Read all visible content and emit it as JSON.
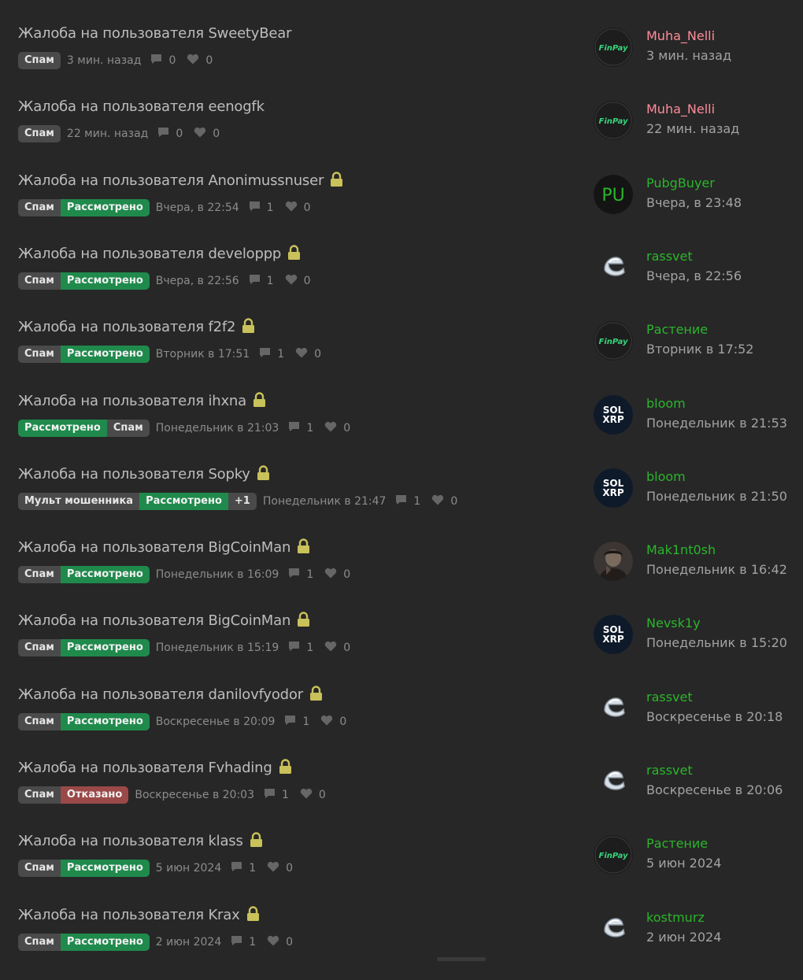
{
  "colors": {
    "background": "#272727",
    "tag_gray": "#4a4a4a",
    "tag_green": "#1f8a4c",
    "tag_red": "#9b4848",
    "user_pink": "#ff8c9a",
    "user_green": "#2bb52b",
    "lock": "#c9c15a"
  },
  "threads": [
    {
      "title": "Жалоба на пользователя SweetyBear",
      "locked": false,
      "tags": [
        {
          "label": "Спам",
          "kind": "gray"
        }
      ],
      "date": "3 мин. назад",
      "replies": "0",
      "likes": "0",
      "user": "Muha_Nelli",
      "user_color": "#ff8c9a",
      "user_date": "3 мин. назад",
      "avatar": "finpay"
    },
    {
      "title": "Жалоба на пользователя eenogfk",
      "locked": false,
      "tags": [
        {
          "label": "Спам",
          "kind": "gray"
        }
      ],
      "date": "22 мин. назад",
      "replies": "0",
      "likes": "0",
      "user": "Muha_Nelli",
      "user_color": "#ff8c9a",
      "user_date": "22 мин. назад",
      "avatar": "finpay"
    },
    {
      "title": "Жалоба на пользователя Anonimussnuser",
      "locked": true,
      "tags": [
        {
          "label": "Спам",
          "kind": "gray"
        },
        {
          "label": "Рассмотрено",
          "kind": "green"
        }
      ],
      "date": "Вчера, в 22:54",
      "replies": "1",
      "likes": "0",
      "user": "PubgBuyer",
      "user_color": "#2bb52b",
      "user_date": "Вчера, в 23:48",
      "avatar": "pu",
      "avatar_text": "PU"
    },
    {
      "title": "Жалоба на пользователя developpp",
      "locked": true,
      "tags": [
        {
          "label": "Спам",
          "kind": "gray"
        },
        {
          "label": "Рассмотрено",
          "kind": "green"
        }
      ],
      "date": "Вчера, в 22:56",
      "replies": "1",
      "likes": "0",
      "user": "rassvet",
      "user_color": "#2bb52b",
      "user_date": "Вчера, в 22:56",
      "avatar": "e"
    },
    {
      "title": "Жалоба на пользователя f2f2",
      "locked": true,
      "tags": [
        {
          "label": "Спам",
          "kind": "gray"
        },
        {
          "label": "Рассмотрено",
          "kind": "green"
        }
      ],
      "date": "Вторник в 17:51",
      "replies": "1",
      "likes": "0",
      "user": "Растение",
      "user_color": "#2bb52b",
      "user_date": "Вторник в 17:52",
      "avatar": "finpay"
    },
    {
      "title": "Жалоба на пользователя ihxna",
      "locked": true,
      "tags": [
        {
          "label": "Рассмотрено",
          "kind": "green"
        },
        {
          "label": "Спам",
          "kind": "gray"
        }
      ],
      "date": "Понедельник в 21:03",
      "replies": "1",
      "likes": "0",
      "user": "bloom",
      "user_color": "#2bb52b",
      "user_date": "Понедельник в 21:53",
      "avatar": "solxrp",
      "avatar_line1": "SOL",
      "avatar_line2": "XRP"
    },
    {
      "title": "Жалоба на пользователя Sopky",
      "locked": true,
      "tags": [
        {
          "label": "Мульт мошенника",
          "kind": "gray"
        },
        {
          "label": "Рассмотрено",
          "kind": "green"
        },
        {
          "label": "+1",
          "kind": "more"
        }
      ],
      "date": "Понедельник в 21:47",
      "replies": "1",
      "likes": "0",
      "user": "bloom",
      "user_color": "#2bb52b",
      "user_date": "Понедельник в 21:50",
      "avatar": "solxrp",
      "avatar_line1": "SOL",
      "avatar_line2": "XRP"
    },
    {
      "title": "Жалоба на пользователя BigCoinMan",
      "locked": true,
      "tags": [
        {
          "label": "Спам",
          "kind": "gray"
        },
        {
          "label": "Рассмотрено",
          "kind": "green"
        }
      ],
      "date": "Понедельник в 16:09",
      "replies": "1",
      "likes": "0",
      "user": "Mak1nt0sh",
      "user_color": "#2bb52b",
      "user_date": "Понедельник в 16:42",
      "avatar": "photo"
    },
    {
      "title": "Жалоба на пользователя BigCoinMan",
      "locked": true,
      "tags": [
        {
          "label": "Спам",
          "kind": "gray"
        },
        {
          "label": "Рассмотрено",
          "kind": "green"
        }
      ],
      "date": "Понедельник в 15:19",
      "replies": "1",
      "likes": "0",
      "user": "Nevsk1y",
      "user_color": "#2bb52b",
      "user_date": "Понедельник в 15:20",
      "avatar": "solxrp",
      "avatar_line1": "SOL",
      "avatar_line2": "XRP"
    },
    {
      "title": "Жалоба на пользователя danilovfyodor",
      "locked": true,
      "tags": [
        {
          "label": "Спам",
          "kind": "gray"
        },
        {
          "label": "Рассмотрено",
          "kind": "green"
        }
      ],
      "date": "Воскресенье в 20:09",
      "replies": "1",
      "likes": "0",
      "user": "rassvet",
      "user_color": "#2bb52b",
      "user_date": "Воскресенье в 20:18",
      "avatar": "e"
    },
    {
      "title": "Жалоба на пользователя Fvhading",
      "locked": true,
      "tags": [
        {
          "label": "Спам",
          "kind": "gray"
        },
        {
          "label": "Отказано",
          "kind": "red"
        }
      ],
      "date": "Воскресенье в 20:03",
      "replies": "1",
      "likes": "0",
      "user": "rassvet",
      "user_color": "#2bb52b",
      "user_date": "Воскресенье в 20:06",
      "avatar": "e"
    },
    {
      "title": "Жалоба на пользователя klass",
      "locked": true,
      "tags": [
        {
          "label": "Спам",
          "kind": "gray"
        },
        {
          "label": "Рассмотрено",
          "kind": "green"
        }
      ],
      "date": "5 июн 2024",
      "replies": "1",
      "likes": "0",
      "user": "Растение",
      "user_color": "#2bb52b",
      "user_date": "5 июн 2024",
      "avatar": "finpay"
    },
    {
      "title": "Жалоба на пользователя Krax",
      "locked": true,
      "tags": [
        {
          "label": "Спам",
          "kind": "gray"
        },
        {
          "label": "Рассмотрено",
          "kind": "green"
        }
      ],
      "date": "2 июн 2024",
      "replies": "1",
      "likes": "0",
      "user": "kostmurz",
      "user_color": "#2bb52b",
      "user_date": "2 июн 2024",
      "avatar": "e"
    }
  ],
  "icons": {
    "lock": "lock-icon",
    "replies": "comment-icon",
    "likes": "heart-icon"
  },
  "finpay_label": "FinPay"
}
